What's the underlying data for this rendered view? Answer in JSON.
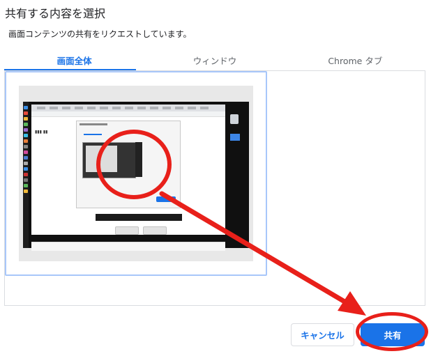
{
  "dialog": {
    "title": "共有する内容を選択",
    "subtitle": "画面コンテンツの共有をリクエストしています。"
  },
  "tabs": [
    {
      "label": "画面全体",
      "active": true
    },
    {
      "label": "ウィンドウ",
      "active": false
    },
    {
      "label": "Chrome タブ",
      "active": false
    }
  ],
  "actions": {
    "cancel_label": "キャンセル",
    "share_label": "共有"
  },
  "colors": {
    "accent": "#1a73e8",
    "annotation_red": "#e8201a",
    "selection_border": "#a8c7fa"
  }
}
